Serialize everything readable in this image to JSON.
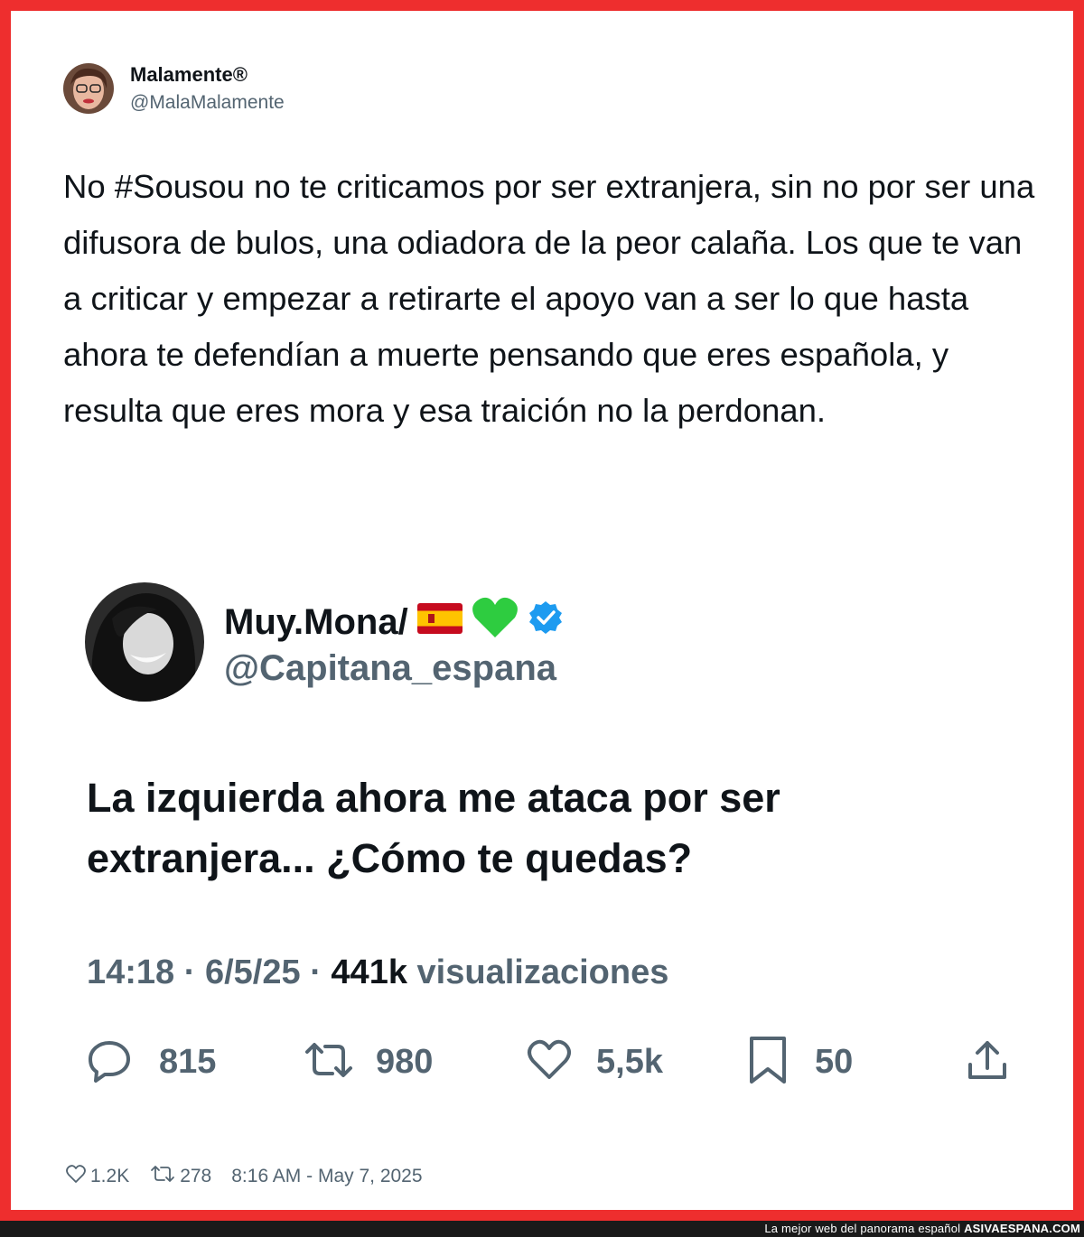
{
  "tweet": {
    "author_name": "Malamente®",
    "author_handle": "@MalaMalamente",
    "text": "No #Sousou no te criticamos por ser extranjera, sin no por ser una difusora de bulos, una odiadora de la peor calaña. Los que te van a criticar y empezar a retirarte el apoyo van a ser lo que hasta ahora te defendían a muerte pensando que eres española, y resulta que eres mora y esa traición no la perdonan.",
    "likes": "1.2K",
    "retweets": "278",
    "timestamp": "8:16 AM - May 7, 2025"
  },
  "quoted": {
    "author_name": "Muy.Mona/",
    "author_handle": "@Capitana_espana",
    "emojis": [
      "spain-flag-icon",
      "green-heart-icon",
      "verified-badge-icon"
    ],
    "text": "La izquierda ahora me ataca por ser extranjera... ¿Cómo te quedas?",
    "time": "14:18",
    "separator": "·",
    "date": "6/5/25",
    "views_count": "441k",
    "views_label": "visualizaciones",
    "replies": "815",
    "reposts": "980",
    "likes": "5,5k",
    "bookmarks": "50"
  },
  "footer": {
    "tagline": "La mejor web del panorama español",
    "site": "ASIVAESPANA.COM"
  },
  "colors": {
    "frame": "#ee2e2e",
    "text": "#0f1419",
    "secondary": "#536471",
    "verified": "#1d9bf0",
    "heart": "#2ecc40"
  }
}
